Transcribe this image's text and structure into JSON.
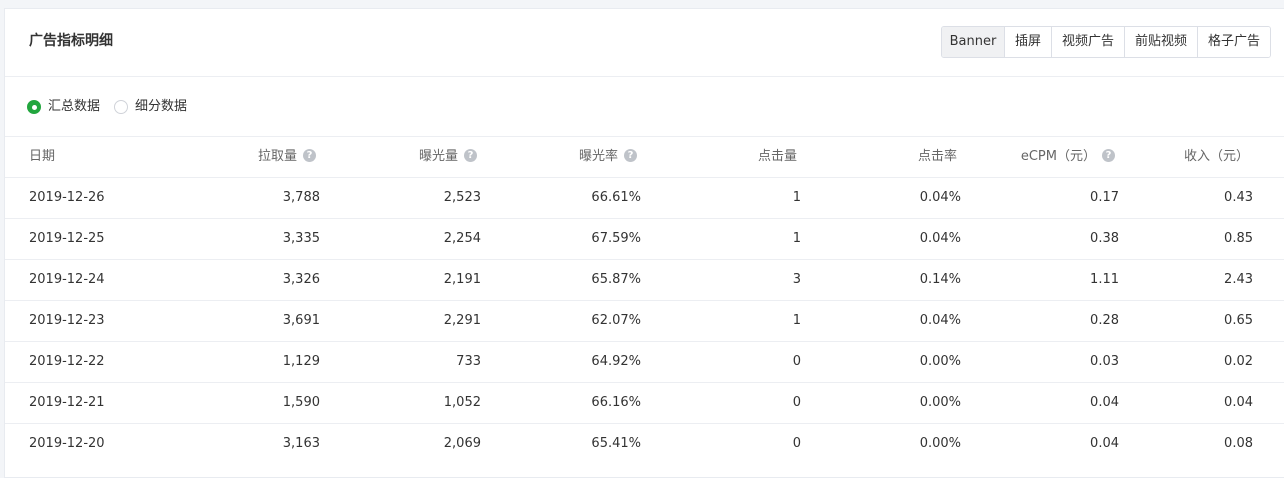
{
  "header": {
    "title": "广告指标明细",
    "tabs": [
      {
        "label": "Banner",
        "active": true
      },
      {
        "label": "插屏",
        "active": false
      },
      {
        "label": "视频广告",
        "active": false
      },
      {
        "label": "前贴视频",
        "active": false
      },
      {
        "label": "格子广告",
        "active": false
      }
    ]
  },
  "radios": [
    {
      "label": "汇总数据",
      "checked": true
    },
    {
      "label": "细分数据",
      "checked": false
    }
  ],
  "table": {
    "columns": [
      {
        "label": "日期",
        "help": false
      },
      {
        "label": "拉取量",
        "help": true
      },
      {
        "label": "曝光量",
        "help": true
      },
      {
        "label": "曝光率",
        "help": true
      },
      {
        "label": "点击量",
        "help": false
      },
      {
        "label": "点击率",
        "help": false
      },
      {
        "label": "eCPM（元）",
        "help": true
      },
      {
        "label": "收入（元）",
        "help": false
      }
    ],
    "rows": [
      [
        "2019-12-26",
        "3,788",
        "2,523",
        "66.61%",
        "1",
        "0.04%",
        "0.17",
        "0.43"
      ],
      [
        "2019-12-25",
        "3,335",
        "2,254",
        "67.59%",
        "1",
        "0.04%",
        "0.38",
        "0.85"
      ],
      [
        "2019-12-24",
        "3,326",
        "2,191",
        "65.87%",
        "3",
        "0.14%",
        "1.11",
        "2.43"
      ],
      [
        "2019-12-23",
        "3,691",
        "2,291",
        "62.07%",
        "1",
        "0.04%",
        "0.28",
        "0.65"
      ],
      [
        "2019-12-22",
        "1,129",
        "733",
        "64.92%",
        "0",
        "0.00%",
        "0.03",
        "0.02"
      ],
      [
        "2019-12-21",
        "1,590",
        "1,052",
        "66.16%",
        "0",
        "0.00%",
        "0.04",
        "0.04"
      ],
      [
        "2019-12-20",
        "3,163",
        "2,069",
        "65.41%",
        "0",
        "0.00%",
        "0.04",
        "0.08"
      ]
    ]
  },
  "icons": {
    "help": "question-circle-icon"
  },
  "colors": {
    "accent": "#22a63e",
    "border": "#eceef2",
    "tab_active_bg": "#f0f1f3"
  }
}
